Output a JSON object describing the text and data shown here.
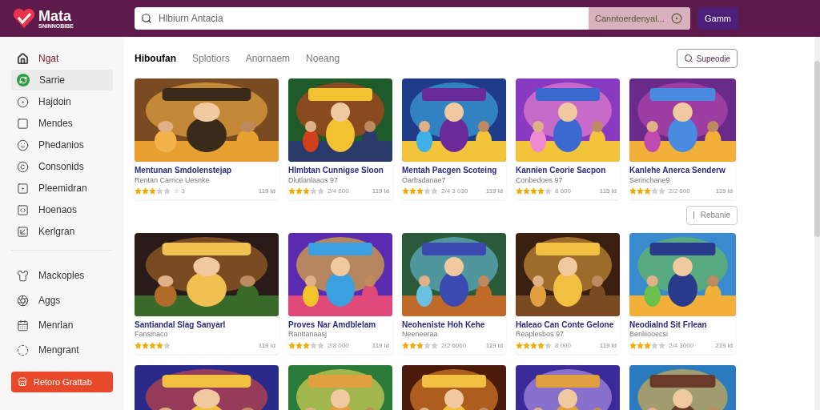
{
  "header": {
    "logo": {
      "name": "Mata",
      "tagline": "SNINNOBIBE"
    },
    "search": {
      "placeholder": "Hlbiurn Antacia"
    },
    "filter": {
      "value": "Canntoerdenyal..."
    },
    "button": "Gamm"
  },
  "sidebar": {
    "groups": [
      {
        "items": [
          {
            "kind": "title",
            "label": "Ngat",
            "selected": false
          },
          {
            "kind": "item",
            "label": "Sarrie",
            "selected": true
          },
          {
            "kind": "item",
            "label": "Hajdoin",
            "selected": false
          },
          {
            "kind": "item",
            "label": "Mendes",
            "selected": false
          },
          {
            "kind": "item",
            "label": "Phedanios",
            "selected": false
          },
          {
            "kind": "item",
            "label": "Consonids",
            "selected": false
          },
          {
            "kind": "item",
            "label": "Pleemidran",
            "selected": false
          },
          {
            "kind": "item",
            "label": "Hoenaos",
            "selected": false
          },
          {
            "kind": "item",
            "label": "Kerlgran",
            "selected": false
          }
        ]
      },
      {
        "items": [
          {
            "kind": "item",
            "label": "Mackoples",
            "selected": false
          },
          {
            "kind": "item",
            "label": "Aggs",
            "selected": false
          },
          {
            "kind": "item",
            "label": "Menrlan",
            "selected": false
          },
          {
            "kind": "item",
            "label": "Mengrant",
            "selected": false
          }
        ]
      }
    ],
    "action_button": "Retoro Grattab"
  },
  "tabs": [
    {
      "label": "Hiboufan",
      "selected": true
    },
    {
      "label": "Splotiors",
      "selected": false
    },
    {
      "label": "Anornaem",
      "selected": false
    },
    {
      "label": "Noeang",
      "selected": false
    }
  ],
  "search_button": "Supeodie",
  "rows": [
    {
      "cards": [
        {
          "title": "Mentunan Smdolenstejap",
          "subtitle": "Rentan Carrice Uesnke",
          "stars": 3,
          "rating": "☆ 3",
          "count": "119 ld"
        },
        {
          "title": "Hlmbtan Cunnigse Sloon",
          "subtitle": "Dlutlanlaaos 97",
          "stars": 3,
          "rating": "2/4 600",
          "count": "119 ld"
        },
        {
          "title": "Mentah Pacgen Scoteing",
          "subtitle": "Oarbsdanae7",
          "stars": 3,
          "rating": "2/4 3 030",
          "count": "119 ld"
        },
        {
          "title": "Kannien Ceorie Sacpon",
          "subtitle": "Conbedoes 97",
          "stars": 4,
          "rating": "8 600",
          "count": "115 ld"
        },
        {
          "title": "Kanlehe Anerca Senderw",
          "subtitle": "Serinchane9",
          "stars": 3,
          "rating": "2/2 600",
          "count": "119 ld"
        }
      ]
    },
    {
      "cards": [
        {
          "title": "Santiandal Slag Sanyarl",
          "subtitle": "Fansinaco",
          "stars": 4,
          "count": "119 ld"
        },
        {
          "title": "Proves Nar Amdblelam",
          "subtitle": "Ranttanaasj",
          "stars": 3,
          "rating": "2/8 000",
          "count": "119 ld"
        },
        {
          "title": "Neoheniste Hoh Kehe",
          "subtitle": "Neeneeraa",
          "stars": 3,
          "rating": "2/2 6060",
          "count": "119 ld"
        },
        {
          "title": "Haleao Can Conte Gelone",
          "subtitle": "Reaplesbos 97",
          "stars": 4,
          "rating": "8 000",
          "count": "119 ld"
        },
        {
          "title": "Neodialnd Sit Frlean",
          "subtitle": "Benliiooecsi",
          "stars": 3,
          "rating": "2/4 3000",
          "count": "219 ld"
        }
      ]
    }
  ],
  "more_button": "Rebanie"
}
